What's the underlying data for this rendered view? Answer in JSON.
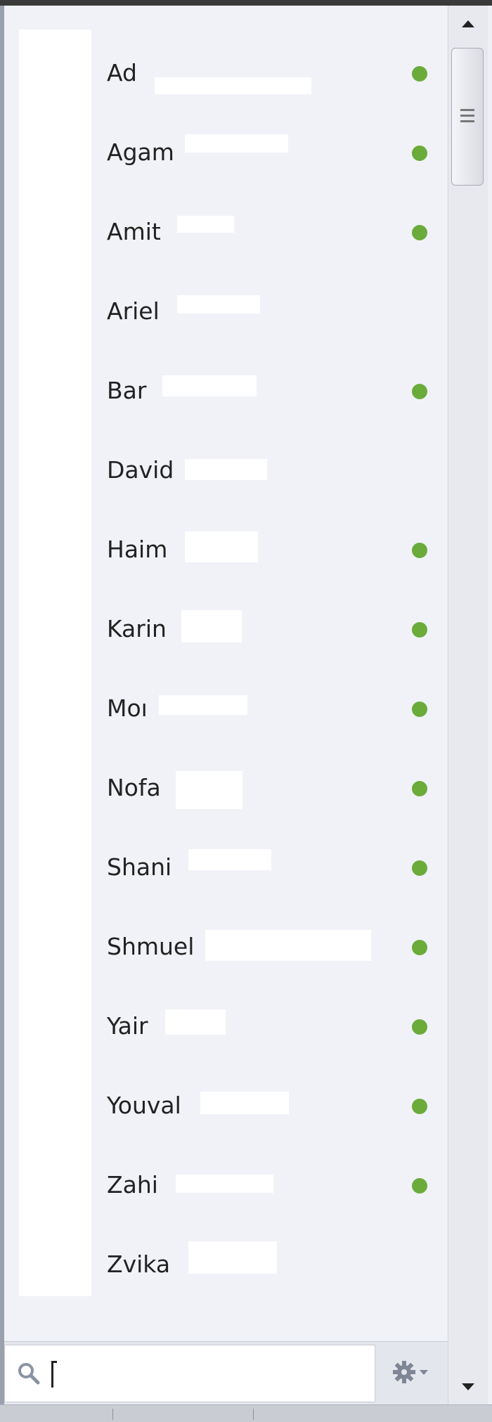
{
  "contacts": [
    {
      "name": "Ad",
      "online": true
    },
    {
      "name": "Agam",
      "online": true
    },
    {
      "name": "Amit",
      "online": true
    },
    {
      "name": "Ariel",
      "online": false
    },
    {
      "name": "Bar",
      "online": true
    },
    {
      "name": "David",
      "online": false
    },
    {
      "name": "Haim",
      "online": true
    },
    {
      "name": "Karin",
      "online": true
    },
    {
      "name": "Moı",
      "online": true
    },
    {
      "name": "Nofa",
      "online": true
    },
    {
      "name": "Shani",
      "online": true
    },
    {
      "name": "Shmuel",
      "online": true
    },
    {
      "name": "Yair",
      "online": true
    },
    {
      "name": "Youval",
      "online": true
    },
    {
      "name": "Zahi",
      "online": true
    },
    {
      "name": "Zvika",
      "online": false
    }
  ],
  "search": {
    "value": "",
    "placeholder": ""
  },
  "icons": {
    "search": "magnifier-icon",
    "settings": "gear-icon",
    "scroll_up": "arrow-up-icon",
    "scroll_down": "arrow-down-icon"
  },
  "colors": {
    "online_dot": "#6aab3a",
    "panel_bg": "#f1f2f7"
  }
}
